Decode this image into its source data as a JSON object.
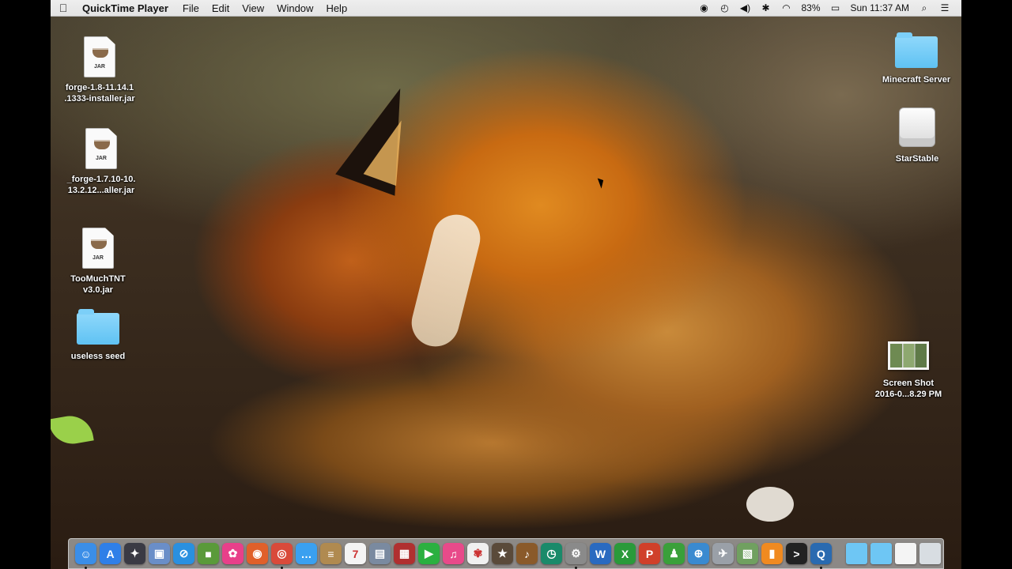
{
  "menubar": {
    "app_name": "QuickTime Player",
    "menus": [
      "File",
      "Edit",
      "View",
      "Window",
      "Help"
    ],
    "battery": "83%",
    "clock": "Sun 11:37 AM"
  },
  "desktop": {
    "left_icons": [
      {
        "name_line1": "forge-1.8-11.14.1",
        "name_line2": ".1333-installer.jar",
        "type": "jar",
        "badge": "JAR"
      },
      {
        "name_line1": "_forge-1.7.10-10.",
        "name_line2": "13.2.12...aller.jar",
        "type": "jar",
        "badge": "JAR"
      },
      {
        "name_line1": "TooMuchTNT",
        "name_line2": "v3.0.jar",
        "type": "jar",
        "badge": "JAR"
      },
      {
        "name_line1": "useless seed",
        "name_line2": "",
        "type": "folder"
      }
    ],
    "right_icons": [
      {
        "name_line1": "Minecraft Server",
        "name_line2": "",
        "type": "folder"
      },
      {
        "name_line1": "StarStable",
        "name_line2": "",
        "type": "drive"
      },
      {
        "name_line1": "Screen Shot",
        "name_line2": "2016-0...8.29 PM",
        "type": "screenshot"
      }
    ]
  },
  "dock": {
    "apps": [
      {
        "name": "finder-icon",
        "color": "#3b8ee8",
        "glyph": "☺",
        "running": true
      },
      {
        "name": "app-store-icon",
        "color": "#2f7fe8",
        "glyph": "A",
        "running": false
      },
      {
        "name": "launchpad-icon",
        "color": "#3a3a44",
        "glyph": "✦",
        "running": false
      },
      {
        "name": "preview-icon",
        "color": "#6a8ec8",
        "glyph": "▣",
        "running": false
      },
      {
        "name": "safari-icon",
        "color": "#2a90e0",
        "glyph": "⊘",
        "running": false
      },
      {
        "name": "minecraft-icon",
        "color": "#5a9a3a",
        "glyph": "■",
        "running": false
      },
      {
        "name": "pinwheel-icon",
        "color": "#e8408a",
        "glyph": "✿",
        "running": false
      },
      {
        "name": "firefox-icon",
        "color": "#e0602a",
        "glyph": "◉",
        "running": false
      },
      {
        "name": "chrome-icon",
        "color": "#d94a3a",
        "glyph": "◎",
        "running": true
      },
      {
        "name": "messages-icon",
        "color": "#3aa0f0",
        "glyph": "…",
        "running": false
      },
      {
        "name": "notes-icon",
        "color": "#b08a50",
        "glyph": "≡",
        "running": false
      },
      {
        "name": "calendar-icon",
        "color": "#f4f4f4",
        "glyph": "7",
        "running": false
      },
      {
        "name": "photo-booth-icon",
        "color": "#7a8aa0",
        "glyph": "▤",
        "running": false
      },
      {
        "name": "photo-collage-icon",
        "color": "#b03030",
        "glyph": "▦",
        "running": false
      },
      {
        "name": "facetime-icon",
        "color": "#2ab040",
        "glyph": "▶",
        "running": false
      },
      {
        "name": "itunes-icon",
        "color": "#e84a8a",
        "glyph": "♫",
        "running": false
      },
      {
        "name": "photos-icon",
        "color": "#f0f0f0",
        "glyph": "✾",
        "running": false
      },
      {
        "name": "imovie-icon",
        "color": "#5a4a3a",
        "glyph": "★",
        "running": false
      },
      {
        "name": "garageband-icon",
        "color": "#8a5a2a",
        "glyph": "♪",
        "running": false
      },
      {
        "name": "time-machine-icon",
        "color": "#1a8a6a",
        "glyph": "◷",
        "running": false
      },
      {
        "name": "system-preferences-icon",
        "color": "#8a8a8a",
        "glyph": "⚙",
        "running": true
      },
      {
        "name": "word-icon",
        "color": "#2a6ac0",
        "glyph": "W",
        "running": false
      },
      {
        "name": "excel-icon",
        "color": "#2a9a3a",
        "glyph": "X",
        "running": false
      },
      {
        "name": "powerpoint-icon",
        "color": "#d0402a",
        "glyph": "P",
        "running": false
      },
      {
        "name": "messenger-icon",
        "color": "#3aa03a",
        "glyph": "♟",
        "running": false
      },
      {
        "name": "network-icon",
        "color": "#3a8ad0",
        "glyph": "⊕",
        "running": false
      },
      {
        "name": "utilities-icon",
        "color": "#9aa0a8",
        "glyph": "✈",
        "running": false
      },
      {
        "name": "image-capture-icon",
        "color": "#70a060",
        "glyph": "▧",
        "running": false
      },
      {
        "name": "ibooks-icon",
        "color": "#f08a20",
        "glyph": "▮",
        "running": false
      },
      {
        "name": "terminal-icon",
        "color": "#222222",
        "glyph": ">",
        "running": false
      },
      {
        "name": "quicktime-icon",
        "color": "#2a6ab0",
        "glyph": "Q",
        "running": true
      }
    ],
    "stacks": [
      {
        "name": "applications-folder-icon",
        "color": "#6ec6f4"
      },
      {
        "name": "downloads-folder-icon",
        "color": "#6ec6f4"
      },
      {
        "name": "document-icon",
        "color": "#f4f4f4"
      },
      {
        "name": "trash-icon",
        "color": "#d8dde2"
      }
    ]
  }
}
